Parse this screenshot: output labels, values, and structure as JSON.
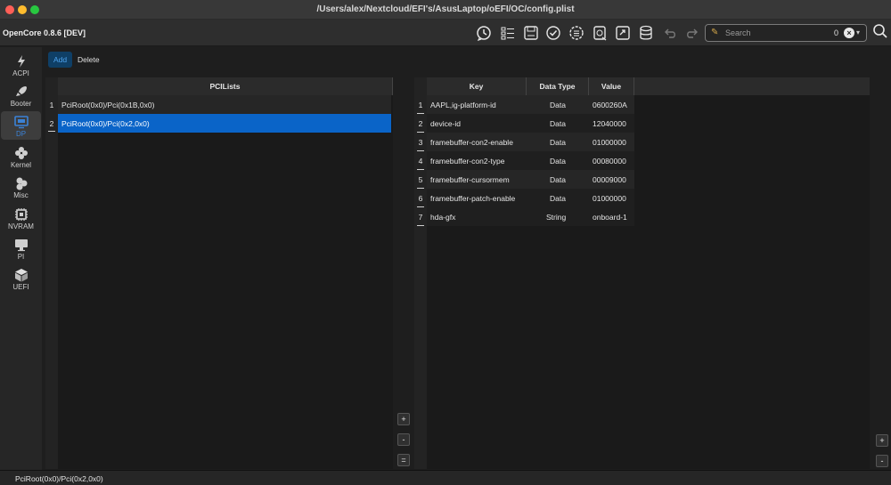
{
  "window": {
    "title": "/Users/alex/Nextcloud/EFI's/AsusLaptop/oEFI/OC/config.plist"
  },
  "traffic_lights": {
    "close": "#ff5f57",
    "minimize": "#febc2e",
    "zoom": "#28c840"
  },
  "app": {
    "name": "OpenCore 0.8.6 [DEV]"
  },
  "toolbar": {
    "icons": [
      "history-clock-icon",
      "list-toggle-icon",
      "save-icon",
      "validate-check-icon",
      "settings-list-icon",
      "import-icon",
      "export-icon",
      "database-icon",
      "undo-icon",
      "redo-icon"
    ],
    "search": {
      "placeholder": "Search",
      "count": "0"
    }
  },
  "sidebar": {
    "items": [
      {
        "label": "ACPI",
        "icon": "bolt-icon"
      },
      {
        "label": "Booter",
        "icon": "rocket-icon"
      },
      {
        "label": "DP",
        "icon": "display-icon",
        "active": true
      },
      {
        "label": "Kernel",
        "icon": "kernel-diamond-icon"
      },
      {
        "label": "Misc",
        "icon": "misc-circles-icon"
      },
      {
        "label": "NVRAM",
        "icon": "chip-icon"
      },
      {
        "label": "PI",
        "icon": "monitor-icon"
      },
      {
        "label": "UEFI",
        "icon": "cube-icon"
      }
    ]
  },
  "actions": {
    "add": "Add",
    "delete": "Delete"
  },
  "left_table": {
    "header": "PCILists",
    "rows": [
      {
        "num": "1",
        "value": "PciRoot(0x0)/Pci(0x1B,0x0)"
      },
      {
        "num": "2",
        "value": "PciRoot(0x0)/Pci(0x2,0x0)",
        "selected": true
      }
    ],
    "buttons": {
      "plus": "+",
      "minus": "-",
      "equals": "="
    }
  },
  "right_table": {
    "headers": {
      "key": "Key",
      "type": "Data Type",
      "value": "Value"
    },
    "rows": [
      {
        "num": "1",
        "key": "AAPL,ig-platform-id",
        "type": "Data",
        "value": "0600260A"
      },
      {
        "num": "2",
        "key": "device-id",
        "type": "Data",
        "value": "12040000"
      },
      {
        "num": "3",
        "key": "framebuffer-con2-enable",
        "type": "Data",
        "value": "01000000"
      },
      {
        "num": "4",
        "key": "framebuffer-con2-type",
        "type": "Data",
        "value": "00080000"
      },
      {
        "num": "5",
        "key": "framebuffer-cursormem",
        "type": "Data",
        "value": "00009000"
      },
      {
        "num": "6",
        "key": "framebuffer-patch-enable",
        "type": "Data",
        "value": "01000000"
      },
      {
        "num": "7",
        "key": "hda-gfx",
        "type": "String",
        "value": "onboard-1"
      }
    ],
    "buttons": {
      "plus": "+",
      "minus": "-"
    }
  },
  "status": {
    "text": "PciRoot(0x0)/Pci(0x2,0x0)"
  },
  "colors": {
    "accent": "#0a64c8",
    "active_label": "#3b82d6",
    "background": "#1e1e1e"
  }
}
